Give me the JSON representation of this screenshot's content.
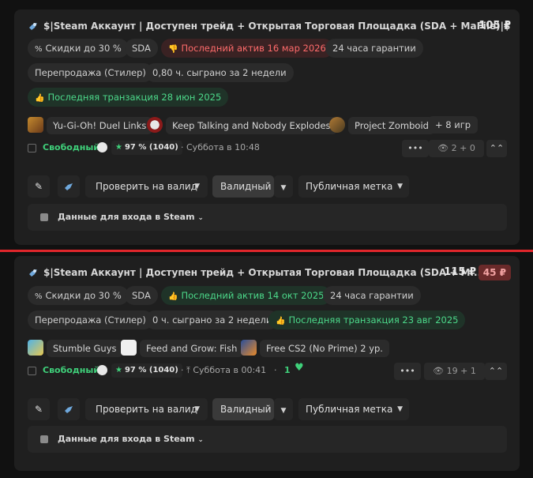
{
  "cards": [
    {
      "title": "$|Steam Аккаунт | Доступен трейд + Открытая Торговая Площадка (SDA + MaFile)|$",
      "price": "105 ₽",
      "tags_row1": [
        "Скидки до 30 %",
        "SDA",
        "Последний актив 16 мар 2026",
        "24 часа гарантии"
      ],
      "tags_row2": [
        "Перепродажа (Стилер)",
        "0,80 ч. сыграно за 2 недели"
      ],
      "tags_row3": [
        "Последняя транзакция 28 июн 2025"
      ],
      "games": [
        "Yu-Gi-Oh! Duel Links",
        "Keep Talking and Nobody Explodes",
        "Project Zomboid",
        "+ 8 игр"
      ],
      "status": "Свободный",
      "rating": "97 % (1040)",
      "date": "Суббота в 10:48",
      "more_label": "•••",
      "views": "2 + 0",
      "up_label": "⌃⌃",
      "check_label": "Проверить на валид",
      "valid_label": "Валидный",
      "public_label": "Публичная метка",
      "login_label": "Данные для входа в Steam"
    },
    {
      "title": "$|Steam Аккаунт | Доступен трейд + Открытая Торговая Площадка (SDA + M...",
      "price": "115 ₽",
      "discount_price": "45 ₽",
      "tags_row1": [
        "Скидки до 30 %",
        "SDA",
        "Последний актив 14 окт 2025",
        "24 часа гарантии"
      ],
      "tags_row2": [
        "Перепродажа (Стилер)",
        "0 ч. сыграно за 2 недели",
        "Последняя транзакция 23 авг 2025"
      ],
      "games": [
        "Stumble Guys",
        "Feed and Grow: Fish",
        "Free CS2 (No Prime) 2 ур."
      ],
      "status": "Свободный",
      "rating": "97 % (1040)",
      "date": "Суббота в 00:41",
      "likes": "1",
      "more_label": "•••",
      "views": "19 + 1",
      "up_label": "⌃⌃",
      "check_label": "Проверить на валид",
      "valid_label": "Валидный",
      "public_label": "Публичная метка",
      "login_label": "Данные для входа в Steam"
    }
  ],
  "colors": {
    "accent_red": "#e0262b",
    "green": "#3fd07a",
    "card_bg": "#1f1f1f"
  }
}
